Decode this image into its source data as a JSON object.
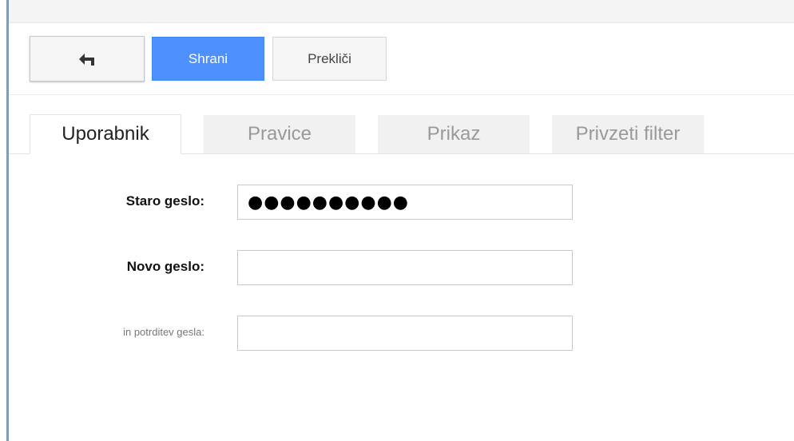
{
  "toolbar": {
    "back_icon": "back-arrow-icon",
    "save_label": "Shrani",
    "cancel_label": "Prekliči",
    "save_color": "#4d90fe"
  },
  "tabs": [
    {
      "label": "Uporabnik",
      "active": true
    },
    {
      "label": "Pravice",
      "active": false
    },
    {
      "label": "Prikaz",
      "active": false
    },
    {
      "label": "Privzeti filter",
      "active": false
    }
  ],
  "form": {
    "old_password": {
      "label": "Staro geslo:",
      "value": "●●●●●●●●●●"
    },
    "new_password": {
      "label": "Novo geslo:",
      "value": ""
    },
    "confirm_password": {
      "label": "in potrditev gesla:",
      "value": ""
    }
  }
}
